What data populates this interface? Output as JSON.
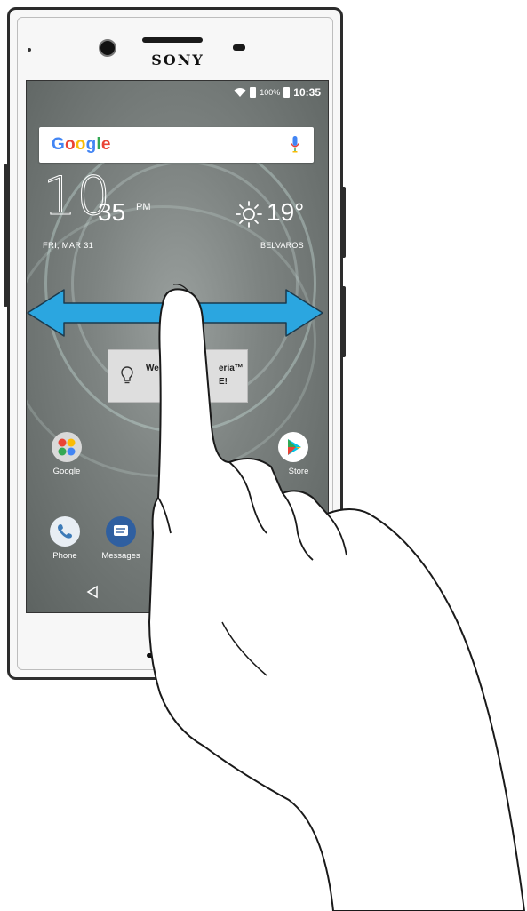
{
  "device": {
    "brand": "SONY"
  },
  "status_bar": {
    "battery_percent": "100%",
    "time": "10:35"
  },
  "search_bar": {
    "logo_text": "Google",
    "logo_colors": [
      "#4285F4",
      "#EA4335",
      "#FBBC05",
      "#4285F4",
      "#34A853",
      "#EA4335"
    ],
    "mic_icon": "microphone-icon"
  },
  "clock_widget": {
    "hours": "10",
    "minutes": "35",
    "ampm": "PM",
    "date": "FRI, MAR 31"
  },
  "weather_widget": {
    "icon": "sun-icon",
    "temperature": "19°",
    "location": "BELVAROS"
  },
  "welcome_card": {
    "text_line1": "We",
    "text_line1_end": "eria™",
    "text_line2": "E!",
    "icon": "lightbulb-icon"
  },
  "home_apps": [
    {
      "label": "Google",
      "icon": "google-folder-icon"
    },
    {
      "label": "Store",
      "icon": "play-store-icon"
    }
  ],
  "dock_apps": [
    {
      "label": "Phone",
      "icon": "phone-icon"
    },
    {
      "label": "Messages",
      "icon": "messages-icon"
    }
  ],
  "navigation": {
    "back_icon": "back-icon"
  },
  "gesture": {
    "type": "swipe left or right",
    "arrow_color": "#2BA6E0",
    "hand_icon": "pointing-hand-icon"
  }
}
